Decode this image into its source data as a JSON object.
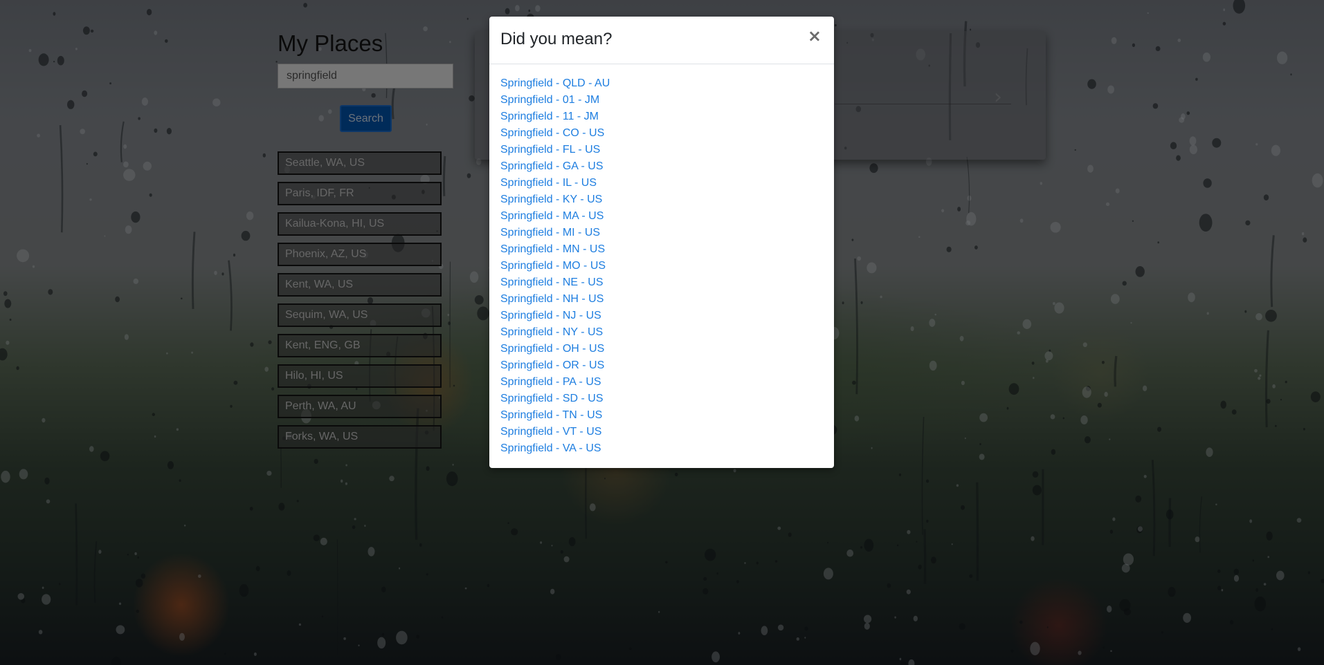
{
  "app": {
    "title": "My Places"
  },
  "search": {
    "value": "springfield",
    "button_label": "Search"
  },
  "places": [
    "Seattle, WA, US",
    "Paris, IDF, FR",
    "Kailua-Kona, HI, US",
    "Phoenix, AZ, US",
    "Kent, WA, US",
    "Sequim, WA, US",
    "Kent, ENG, GB",
    "Hilo, HI, US",
    "Perth, WA, AU",
    "Forks, WA, US"
  ],
  "modal": {
    "title": "Did you mean?",
    "close_label": "×",
    "suggestions": [
      "Springfield - QLD - AU",
      "Springfield - 01 - JM",
      "Springfield - 11 - JM",
      "Springfield - CO - US",
      "Springfield - FL - US",
      "Springfield - GA - US",
      "Springfield - IL - US",
      "Springfield - KY - US",
      "Springfield - MA - US",
      "Springfield - MI - US",
      "Springfield - MN - US",
      "Springfield - MO - US",
      "Springfield - NE - US",
      "Springfield - NH - US",
      "Springfield - NJ - US",
      "Springfield - NY - US",
      "Springfield - OH - US",
      "Springfield - OR - US",
      "Springfield - PA - US",
      "Springfield - SD - US",
      "Springfield - TN - US",
      "Springfield - VT - US",
      "Springfield - VA - US"
    ]
  },
  "colors": {
    "link": "#1e7ee0",
    "primary_button": "#0056b3"
  },
  "icons": {
    "close": "close-icon",
    "next": "chevron-right-icon"
  }
}
